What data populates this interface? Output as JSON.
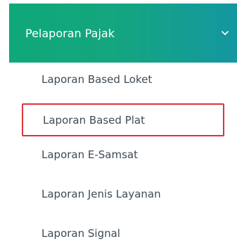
{
  "menu": {
    "header_label": "Pelaporan Pajak",
    "chevron_icon": "chevron-down-icon",
    "gradient": [
      "#0fa879",
      "#1397a1"
    ],
    "items": [
      {
        "label": "Laporan Based Loket"
      },
      {
        "label": "Laporan Based Plat",
        "highlighted": true,
        "highlight_color": "#d9343a"
      },
      {
        "label": "Laporan E-Samsat"
      },
      {
        "label": "Laporan Jenis Layanan"
      },
      {
        "label": "Laporan Signal"
      }
    ]
  }
}
